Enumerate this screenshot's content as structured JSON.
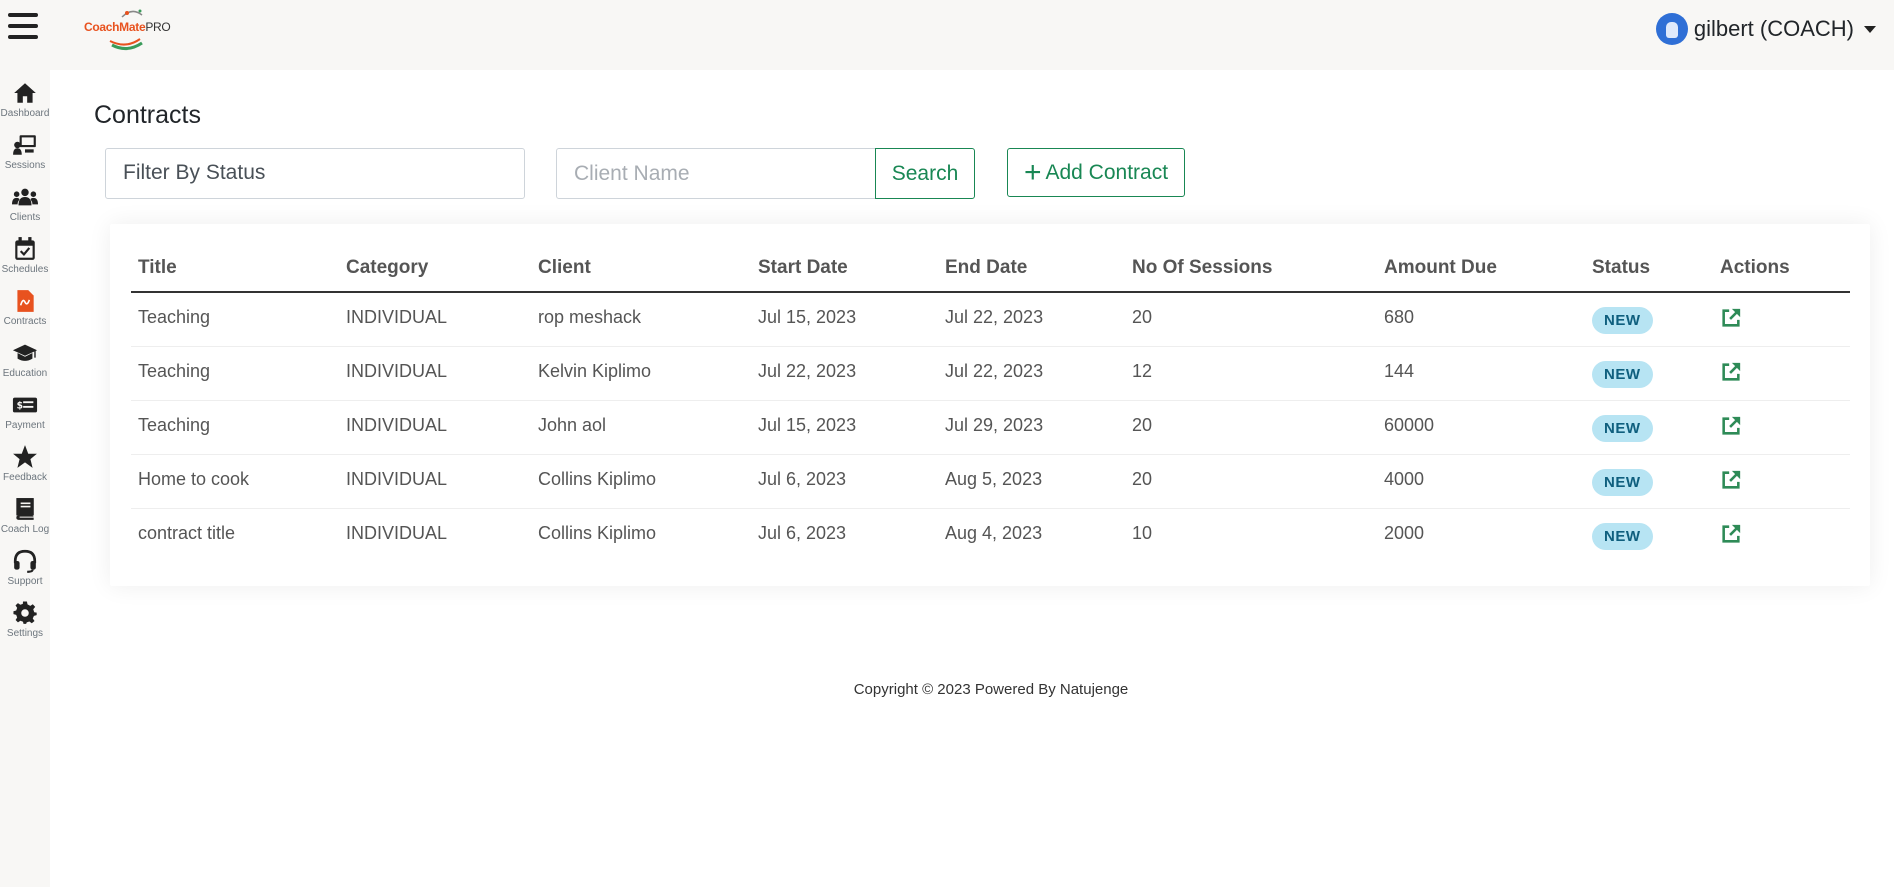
{
  "header": {
    "logo_text_main": "CoachMate",
    "logo_text_pro": "PRO",
    "user_label": "gilbert (COACH)"
  },
  "sidebar": {
    "items": [
      {
        "label": "Dashboard",
        "icon": "home-icon"
      },
      {
        "label": "Sessions",
        "icon": "presentation-icon"
      },
      {
        "label": "Clients",
        "icon": "users-icon"
      },
      {
        "label": "Schedules",
        "icon": "calendar-check-icon"
      },
      {
        "label": "Contracts",
        "icon": "contract-file-icon"
      },
      {
        "label": "Education",
        "icon": "graduation-cap-icon"
      },
      {
        "label": "Payment",
        "icon": "money-bill-icon"
      },
      {
        "label": "Feedback",
        "icon": "star-icon"
      },
      {
        "label": "Coach Log",
        "icon": "book-icon"
      },
      {
        "label": "Support",
        "icon": "headset-icon"
      },
      {
        "label": "Settings",
        "icon": "gear-icon"
      }
    ]
  },
  "page": {
    "title": "Contracts",
    "filter_placeholder": "Filter By Status",
    "client_placeholder": "Client Name",
    "search_label": "Search",
    "add_label": "Add Contract"
  },
  "table": {
    "columns": [
      "Title",
      "Category",
      "Client",
      "Start Date",
      "End Date",
      "No Of Sessions",
      "Amount Due",
      "Status",
      "Actions"
    ],
    "rows": [
      {
        "title": "Teaching",
        "category": "INDIVIDUAL",
        "client": "rop meshack",
        "start": "Jul 15, 2023",
        "end": "Jul 22, 2023",
        "sessions": "20",
        "amount": "680",
        "status": "NEW"
      },
      {
        "title": "Teaching",
        "category": "INDIVIDUAL",
        "client": "Kelvin Kiplimo",
        "start": "Jul 22, 2023",
        "end": "Jul 22, 2023",
        "sessions": "12",
        "amount": "144",
        "status": "NEW"
      },
      {
        "title": "Teaching",
        "category": "INDIVIDUAL",
        "client": "John aol",
        "start": "Jul 15, 2023",
        "end": "Jul 29, 2023",
        "sessions": "20",
        "amount": "60000",
        "status": "NEW"
      },
      {
        "title": "Home to cook",
        "category": "INDIVIDUAL",
        "client": "Collins Kiplimo",
        "start": "Jul 6, 2023",
        "end": "Aug 5, 2023",
        "sessions": "20",
        "amount": "4000",
        "status": "NEW"
      },
      {
        "title": "contract title",
        "category": "INDIVIDUAL",
        "client": "Collins Kiplimo",
        "start": "Jul 6, 2023",
        "end": "Aug 4, 2023",
        "sessions": "10",
        "amount": "2000",
        "status": "NEW"
      }
    ]
  },
  "footer": {
    "text": "Copyright © 2023 Powered By Natujenge"
  },
  "colors": {
    "accent": "#198754",
    "badge_bg": "#b7e4f3",
    "active_sidebar": "#e8521f"
  }
}
